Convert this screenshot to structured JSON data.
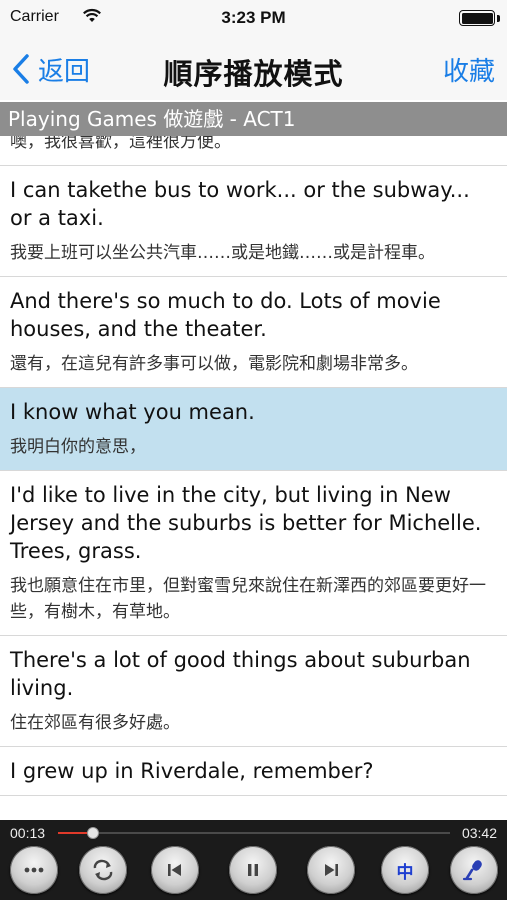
{
  "status_bar": {
    "carrier": "Carrier",
    "time": "3:23 PM"
  },
  "nav": {
    "back_label": "返回",
    "title": "順序播放模式",
    "favorite_label": "收藏"
  },
  "section_header": "Playing Games 做遊戲 - ACT1",
  "lines": [
    {
      "en": "",
      "zh": "噢，我很喜歡，這裡很方便。"
    },
    {
      "en": "I can takethe bus to work... or the subway... or a taxi.",
      "zh": "我要上班可以坐公共汽車……或是地鐵……或是計程車。"
    },
    {
      "en": "And there's so much to do. Lots of movie houses, and the theater.",
      "zh": "還有，在這兒有許多事可以做，電影院和劇場非常多。"
    },
    {
      "en": "I know what you mean.",
      "zh": "我明白你的意思，"
    },
    {
      "en": "I'd like to live in the city, but living in New Jersey and the suburbs is better for Michelle. Trees, grass.",
      "zh": "我也願意住在市里，但對蜜雪兒來說住在新澤西的郊區要更好一些，有樹木，有草地。"
    },
    {
      "en": "There's a lot of good things about suburban living.",
      "zh": "住在郊區有很多好處。"
    },
    {
      "en": "I grew up in Riverdale, remember?",
      "zh": ""
    }
  ],
  "selected_line_index": 3,
  "player": {
    "elapsed": "00:13",
    "total": "03:42",
    "progress_fraction": 0.09,
    "chinese_toggle_label": "中"
  },
  "icons": {
    "more": "more-icon",
    "repeat": "repeat-icon",
    "previous": "previous-icon",
    "pause": "pause-icon",
    "next": "next-icon",
    "chinese": "chinese-toggle",
    "record": "microphone-icon"
  },
  "colors": {
    "accent": "#1a7ee6",
    "section_header_bg": "#8e8e8e",
    "selected_row_bg": "#c2e0ef",
    "player_bg": "#1b1b1b",
    "progress": "#e03a2a"
  }
}
